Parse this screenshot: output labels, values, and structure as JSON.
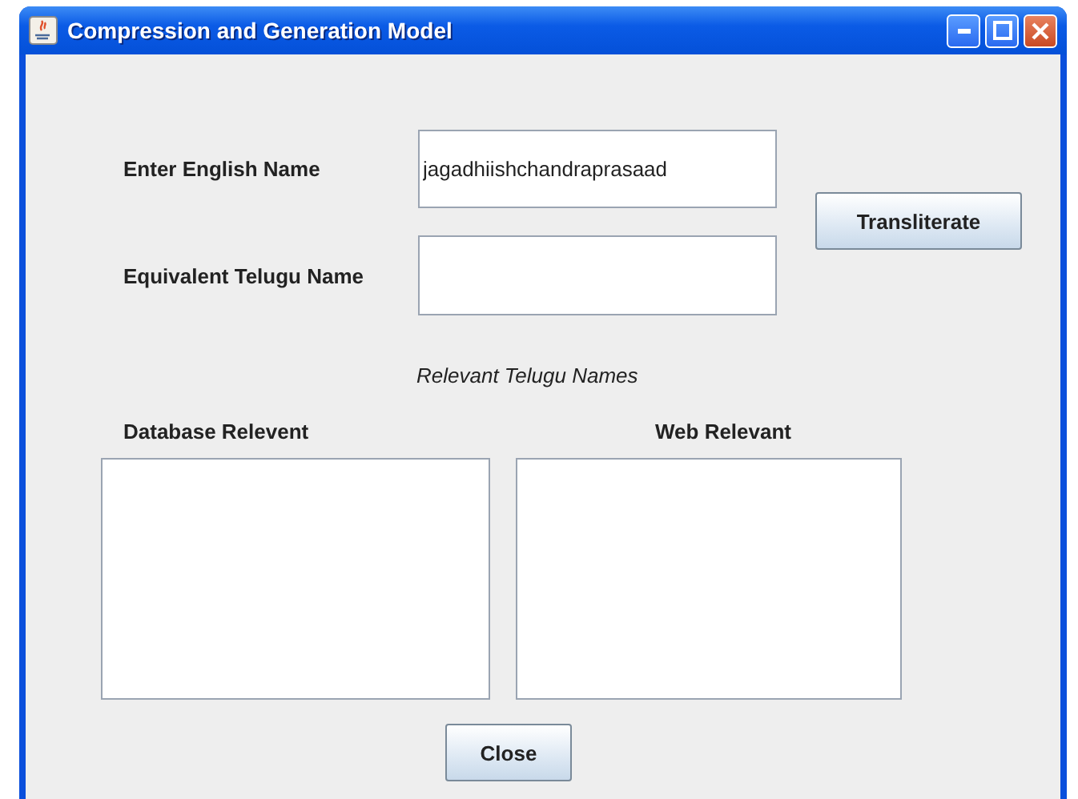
{
  "window": {
    "title": "Compression and Generation Model"
  },
  "form": {
    "english_name": {
      "label": "Enter English Name",
      "value": "jagadhiishchandraprasaad"
    },
    "telugu_name": {
      "label": "Equivalent Telugu Name"
    },
    "transliterate_button": "Transliterate"
  },
  "relevant": {
    "heading": "Relevant Telugu Names",
    "database_label": "Database Relevent",
    "web_label": "Web Relevant"
  },
  "close_button": "Close"
}
